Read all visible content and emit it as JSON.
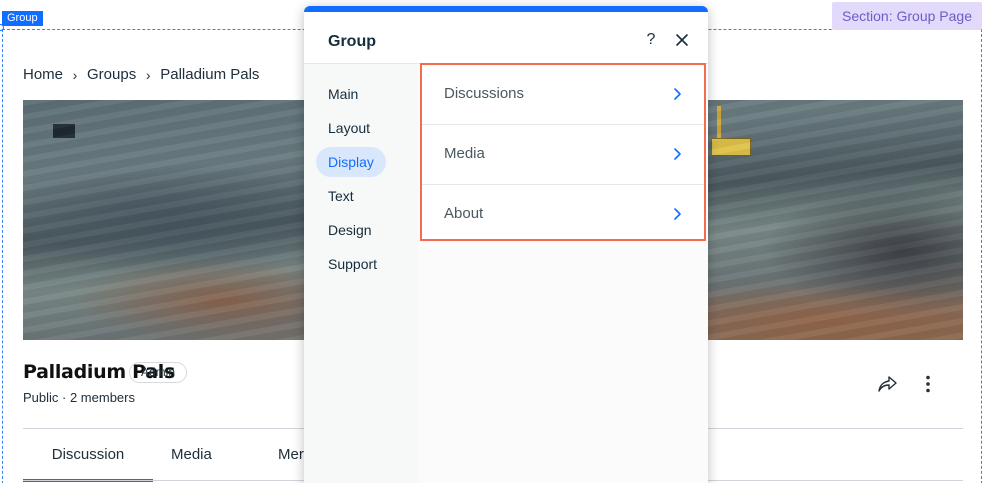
{
  "editor": {
    "element_tag": "Group",
    "section_tag": "Section: Group Page",
    "accent_color": "#116dff",
    "highlight_color": "#f26c4f"
  },
  "page": {
    "breadcrumb": [
      "Home",
      "Groups",
      "Palladium Pals"
    ],
    "group_name": "Palladium Pals",
    "role_badge": "Admin",
    "meta": "Public · 2 members",
    "tabs": [
      {
        "label": "Discussion",
        "active": true
      },
      {
        "label": "Media",
        "active": false
      },
      {
        "label": "Mer",
        "active": false
      }
    ]
  },
  "panel": {
    "title": "Group",
    "help_label": "?",
    "nav": [
      {
        "label": "Main",
        "active": false
      },
      {
        "label": "Layout",
        "active": false
      },
      {
        "label": "Display",
        "active": true
      },
      {
        "label": "Text",
        "active": false
      },
      {
        "label": "Design",
        "active": false
      },
      {
        "label": "Support",
        "active": false
      }
    ],
    "options": [
      "Discussions",
      "Media",
      "About"
    ]
  }
}
